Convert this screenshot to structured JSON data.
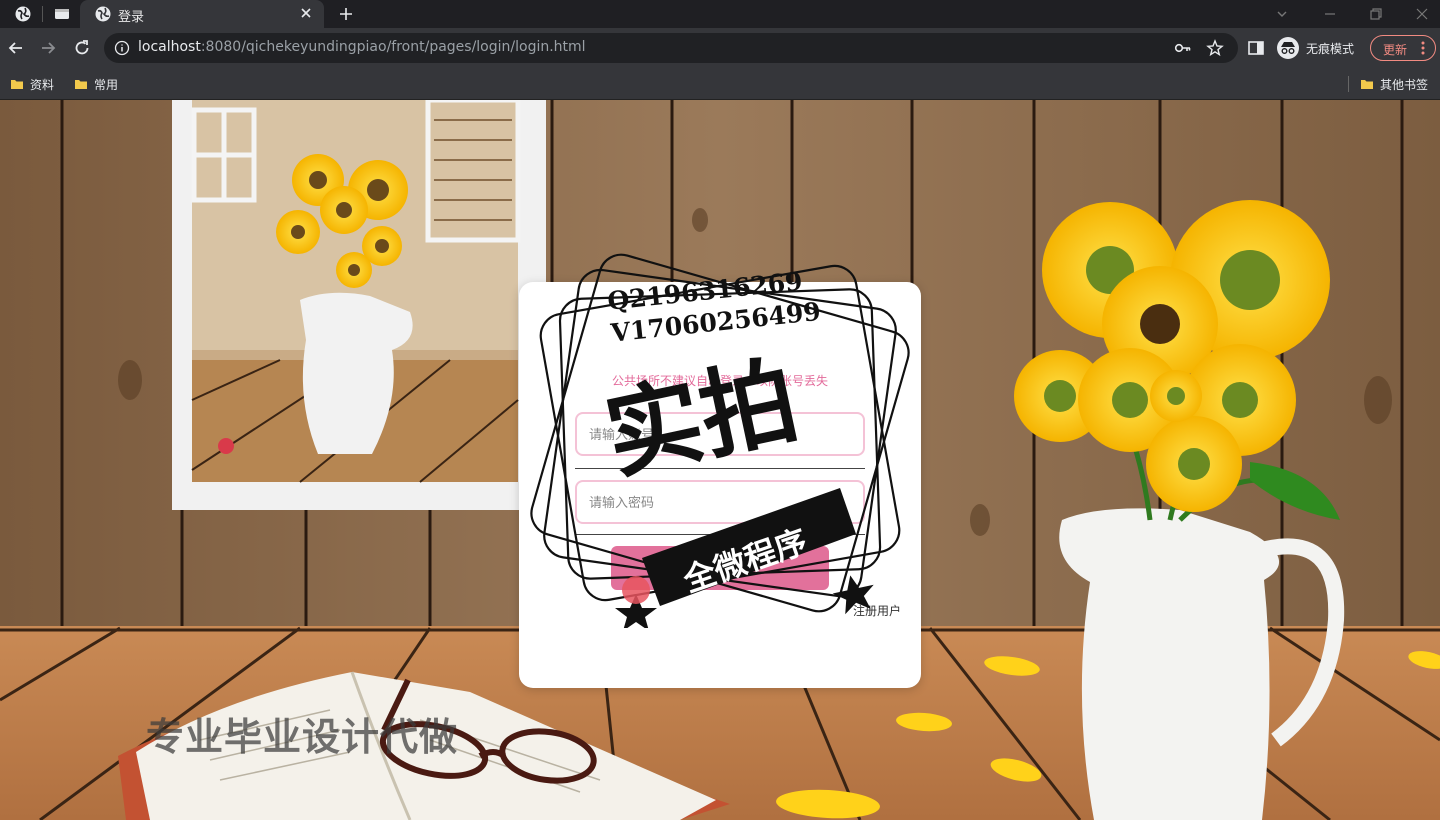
{
  "browser": {
    "tab_title": "登录",
    "url_host": "localhost",
    "url_rest": ":8080/qichekeyundingpiao/front/pages/login/login.html",
    "incognito_label": "无痕模式",
    "update_label": "更新",
    "bookmarks": [
      "资料",
      "常用"
    ],
    "other_bookmarks": "其他书签"
  },
  "login": {
    "warning": "公共场所不建议自动登录，以防账号丢失",
    "username_placeholder": "请输入账号",
    "password_placeholder": "请输入密码",
    "login_button": "登录",
    "register_link": "注册用户"
  },
  "watermark": {
    "contact_q": "Q2196316269",
    "contact_v": "V17060256499",
    "big_text": "实拍",
    "banner_text": "全微程序",
    "footer_text": "专业毕业设计代做"
  },
  "colors": {
    "accent": "#e2719b",
    "field_border": "#f4c2d6",
    "warning_text": "#e36b9b"
  }
}
